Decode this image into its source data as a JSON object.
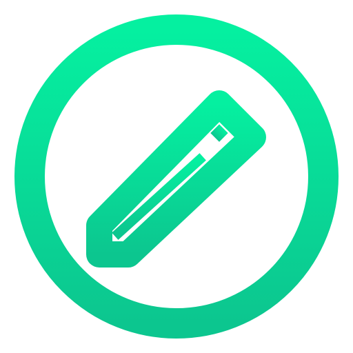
{
  "icon": {
    "name": "edit-pencil-icon",
    "shape": "pencil inside circle",
    "colors": {
      "gradient_top": "#05F0A0",
      "gradient_bottom": "#0CC68F",
      "background": "#FFFFFF"
    }
  }
}
